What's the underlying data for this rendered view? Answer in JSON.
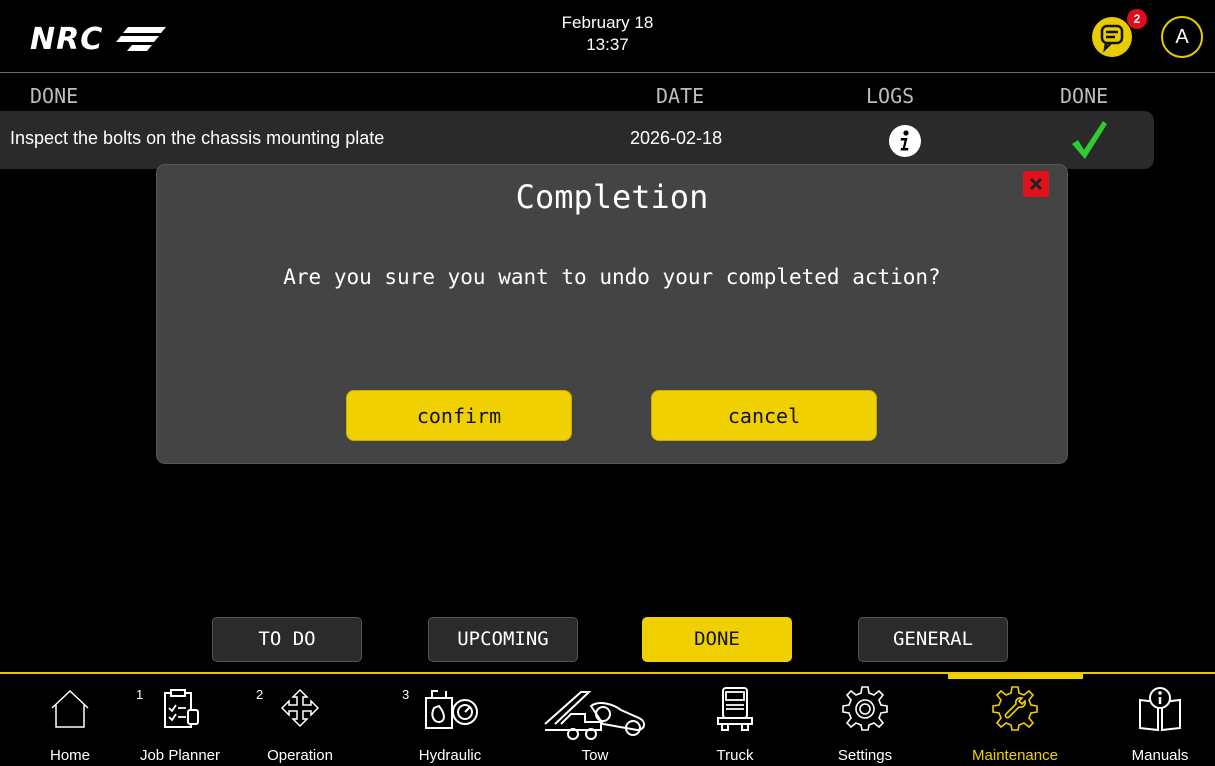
{
  "header": {
    "logo": "NRC",
    "date": "February 18",
    "time": "13:37",
    "notification_count": "2",
    "user_initial": "A"
  },
  "table": {
    "section_label": "DONE",
    "columns": {
      "date": "DATE",
      "logs": "LOGS",
      "done": "DONE"
    },
    "rows": [
      {
        "task": "Inspect the bolts on the chassis mounting plate",
        "date": "2026-02-18"
      }
    ]
  },
  "modal": {
    "title": "Completion",
    "message": "Are you sure you want to undo your completed action?",
    "confirm_label": "confirm",
    "cancel_label": "cancel"
  },
  "tabs": [
    {
      "label": "TO DO",
      "active": false
    },
    {
      "label": "UPCOMING",
      "active": false
    },
    {
      "label": "DONE",
      "active": true
    },
    {
      "label": "GENERAL",
      "active": false
    }
  ],
  "nav": [
    {
      "label": "Home",
      "num": "",
      "icon": "home-icon"
    },
    {
      "label": "Job Planner",
      "num": "1",
      "icon": "clipboard-icon"
    },
    {
      "label": "Operation",
      "num": "2",
      "icon": "move-arrows-icon"
    },
    {
      "label": "Hydraulic",
      "num": "3",
      "icon": "hydraulic-gauge-icon"
    },
    {
      "label": "Tow",
      "num": "",
      "icon": "tow-truck-icon"
    },
    {
      "label": "Truck",
      "num": "",
      "icon": "truck-icon"
    },
    {
      "label": "Settings",
      "num": "",
      "icon": "gear-icon"
    },
    {
      "label": "Maintenance",
      "num": "",
      "icon": "wrench-gear-icon",
      "active": true
    },
    {
      "label": "Manuals",
      "num": "",
      "icon": "manual-book-icon"
    }
  ],
  "colors": {
    "accent": "#f0d000",
    "close": "#e0121c",
    "check": "#2ecc2e",
    "badge": "#e00d1b"
  }
}
